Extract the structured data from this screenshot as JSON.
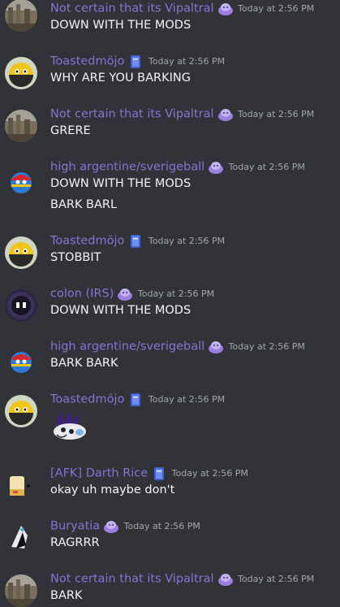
{
  "messages": [
    {
      "user": "Not certain that its Vipaltral",
      "time": "Today at 2:56 PM",
      "avatar": "ruins-avatar",
      "badge": "purple-blob",
      "lines": [
        "DOWN WITH THE MODS"
      ]
    },
    {
      "user": "Toastedmöjo",
      "time": "Today at 2:56 PM",
      "avatar": "yellow-ball-avatar",
      "badge": "blue-book",
      "lines": [
        "WHY ARE YOU BARKING"
      ]
    },
    {
      "user": "Not certain that its Vipaltral",
      "time": "Today at 2:56 PM",
      "avatar": "ruins-avatar",
      "badge": "purple-blob",
      "lines": [
        "GRERE"
      ]
    },
    {
      "user": "high argentine/sverigeball",
      "time": "Today at 2:56 PM",
      "avatar": "flag-ball-avatar",
      "badge": "purple-blob",
      "lines": [
        "DOWN WITH THE MODS",
        "BARK BARL"
      ]
    },
    {
      "user": "Toastedmöjo",
      "time": "Today at 2:56 PM",
      "avatar": "yellow-ball-avatar",
      "badge": "blue-book",
      "lines": [
        "STOBBIT"
      ]
    },
    {
      "user": "colon (IRS)",
      "time": "Today at 2:56 PM",
      "avatar": "dark-face-avatar",
      "badge": "purple-blob",
      "lines": [
        "DOWN WITH THE MODS"
      ]
    },
    {
      "user": "high argentine/sverigeball",
      "time": "Today at 2:56 PM",
      "avatar": "flag-ball-avatar",
      "badge": "purple-blob",
      "lines": [
        "BARK BARK"
      ]
    },
    {
      "user": "Toastedmöjo",
      "time": "Today at 2:56 PM",
      "avatar": "yellow-ball-avatar",
      "badge": "blue-book",
      "lines": [],
      "sticker": "purple-creature-sticker"
    },
    {
      "user": "[AFK] Darth Rice",
      "time": "Today at 2:56 PM",
      "avatar": "rice-avatar",
      "badge": "blue-book",
      "lines": [
        "okay uh maybe don't"
      ]
    },
    {
      "user": "Buryatia",
      "time": "Today at 2:56 PM",
      "avatar": "shark-avatar",
      "badge": "purple-blob",
      "lines": [
        "RAGRRR"
      ]
    },
    {
      "user": "Not certain that its Vipaltral",
      "time": "Today at 2:56 PM",
      "avatar": "ruins-avatar",
      "badge": "purple-blob",
      "lines": [
        "BARK"
      ]
    }
  ],
  "colors": {
    "background": "#313338",
    "username": "#8b72d4",
    "text": "#f2f3f5",
    "timestamp": "#a3a6aa"
  }
}
